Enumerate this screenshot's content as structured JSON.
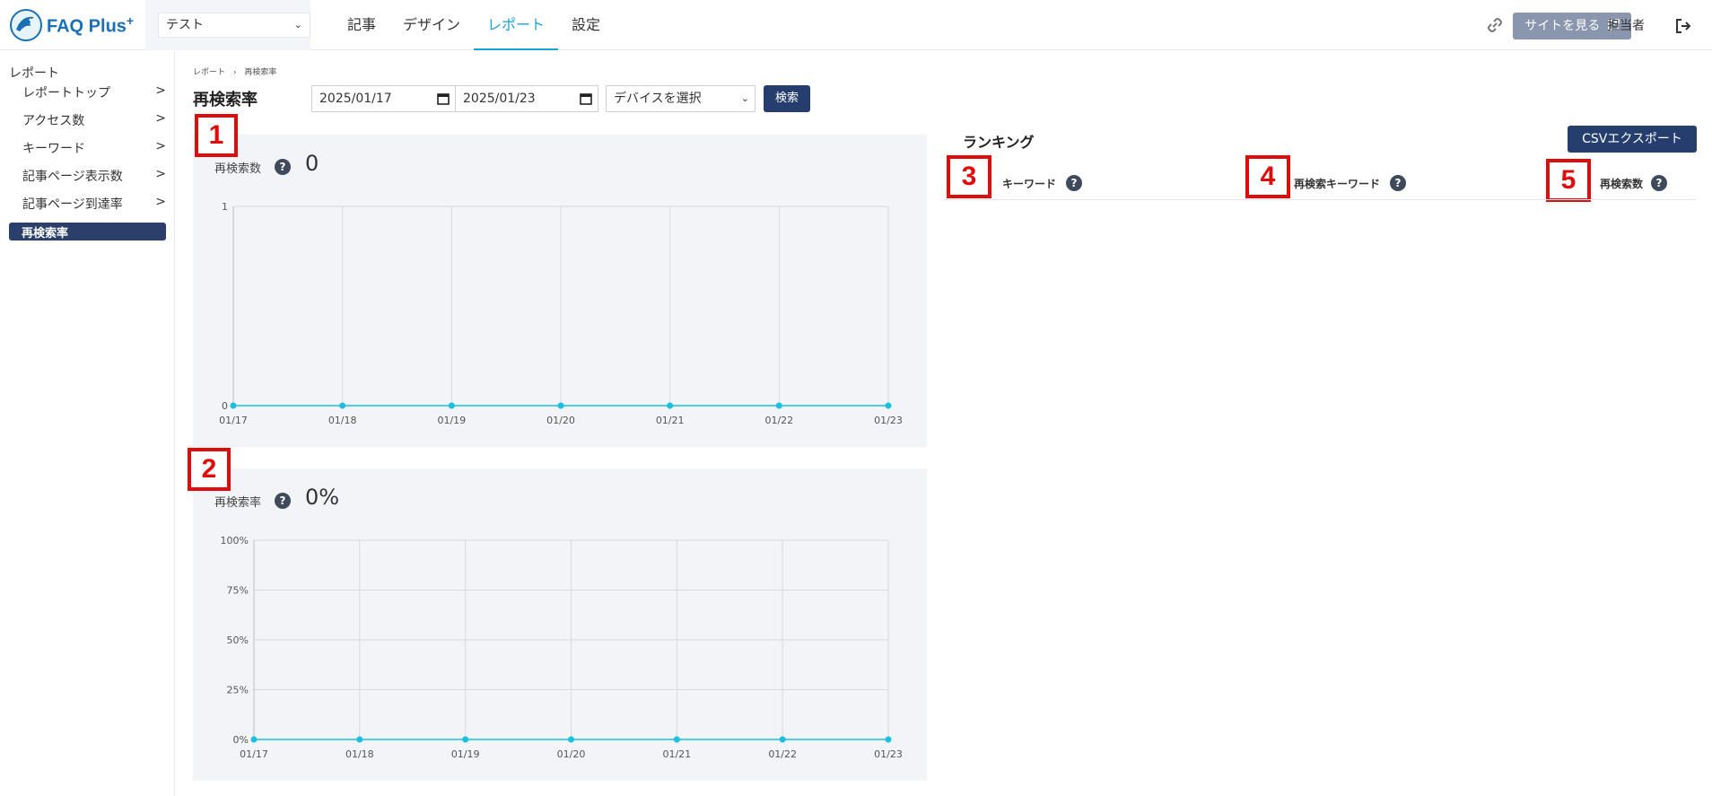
{
  "header": {
    "logo_text": "FAQ Plus",
    "logo_plus": "+",
    "site_selector": "テスト",
    "nav": [
      {
        "label": "記事"
      },
      {
        "label": "デザイン"
      },
      {
        "label": "レポート"
      },
      {
        "label": "設定"
      }
    ],
    "view_site_label": "サイトを見る",
    "user_label": "担当者",
    "icons": {
      "link": "link-icon",
      "external": "external-link-icon",
      "logout": "logout-icon"
    }
  },
  "sidebar": {
    "root_label": "レポート",
    "items": [
      {
        "label": "レポートトップ",
        "arrow": ">"
      },
      {
        "label": "アクセス数",
        "arrow": ">"
      },
      {
        "label": "キーワード",
        "arrow": ">"
      },
      {
        "label": "記事ページ表示数",
        "arrow": ">"
      },
      {
        "label": "記事ページ到達率",
        "arrow": ">"
      },
      {
        "label": "再検索率",
        "arrow": ""
      }
    ],
    "active_index": 5
  },
  "breadcrumb": {
    "parent": "レポート",
    "separator": "›",
    "current": "再検索率"
  },
  "page_title": "再検索率",
  "filters": {
    "start_date": "2025/01/17",
    "end_date": "2025/01/23",
    "device_placeholder": "デバイスを選択",
    "search_label": "検索"
  },
  "panels": {
    "count": {
      "label": "再検索数",
      "help": "?",
      "value": "0",
      "marker": "1"
    },
    "rate": {
      "label": "再検索率",
      "help": "?",
      "value": "0%",
      "marker": "2"
    }
  },
  "chart_data": [
    {
      "type": "line",
      "x": [
        "01/17",
        "01/18",
        "01/19",
        "01/20",
        "01/21",
        "01/22",
        "01/23"
      ],
      "series": [
        {
          "values": [
            0,
            0,
            0,
            0,
            0,
            0,
            0
          ]
        }
      ],
      "ylim": [
        0,
        1
      ],
      "yticks": [
        "0",
        "1"
      ],
      "grid": true,
      "color": "#1bc0e0"
    },
    {
      "type": "line",
      "x": [
        "01/17",
        "01/18",
        "01/19",
        "01/20",
        "01/21",
        "01/22",
        "01/23"
      ],
      "series": [
        {
          "values": [
            0,
            0,
            0,
            0,
            0,
            0,
            0
          ]
        }
      ],
      "ylim": [
        0,
        100
      ],
      "yticks": [
        "0%",
        "25%",
        "50%",
        "75%",
        "100%"
      ],
      "grid": true,
      "color": "#1bc0e0"
    }
  ],
  "ranking": {
    "title": "ランキング",
    "csv_label": "CSVエクスポート",
    "columns": [
      {
        "label": "キーワード",
        "help": "?",
        "marker": "3"
      },
      {
        "label": "再検索キーワード",
        "help": "?",
        "marker": "4"
      },
      {
        "label": "再検索数",
        "help": "?",
        "marker": "5"
      }
    ]
  },
  "colors": {
    "primary": "#263e6e",
    "accent": "#1aa3d8",
    "marker": "#e00b0b",
    "panel_bg": "#f2f4f8"
  }
}
